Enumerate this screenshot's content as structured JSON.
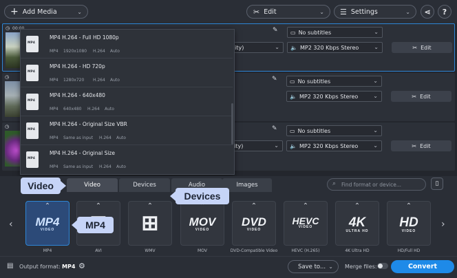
{
  "toolbar": {
    "add_media": "Add Media",
    "edit": "Edit",
    "settings": "Settings",
    "share_icon": "share-icon",
    "help": "?"
  },
  "files": [
    {
      "time": "00:00",
      "subtitles": "No subtitles",
      "audio": "MP2 320 Kbps Stereo",
      "quality": "ality)",
      "edit": "Edit"
    },
    {
      "subtitles": "No subtitles",
      "audio": "MP2 320 Kbps Stereo",
      "edit": "Edit"
    },
    {
      "subtitles": "No subtitles",
      "audio": "MP2 320 Kbps Stereo",
      "quality": "ality)",
      "edit": "Edit"
    }
  ],
  "dropdown": {
    "items": [
      {
        "title": "MP4 H.264 - Full HD 1080p",
        "fmt": "MP4",
        "size": "1920x1080",
        "codec": "H.264",
        "rate": "Auto"
      },
      {
        "title": "MP4 H.264 - HD 720p",
        "fmt": "MP4",
        "size": "1280x720",
        "codec": "H.264",
        "rate": "Auto"
      },
      {
        "title": "MP4 H.264 - 640x480",
        "fmt": "MP4",
        "size": "640x480",
        "codec": "H.264",
        "rate": "Auto"
      },
      {
        "title": "MP4 H.264 - Original Size VBR",
        "fmt": "MP4",
        "size": "Same as input",
        "codec": "H.264",
        "rate": "Auto"
      },
      {
        "title": "MP4 H.264 - Original Size",
        "fmt": "MP4",
        "size": "Same as input",
        "codec": "H.264",
        "rate": "Auto"
      }
    ]
  },
  "tabs": [
    "Video",
    "Devices",
    "Audio",
    "Images"
  ],
  "search": {
    "placeholder": "Find format or device..."
  },
  "callouts": {
    "video": "Video",
    "devices": "Devices",
    "mp4": "MP4"
  },
  "formats": [
    {
      "logo": "MP4",
      "sub": "VIDEO",
      "label": "MP4"
    },
    {
      "logo": "⊞",
      "sub": "",
      "label": "AVI"
    },
    {
      "logo": "⊞",
      "sub": "",
      "label": "WMV"
    },
    {
      "logo": "MOV",
      "sub": "VIDEO",
      "label": "MOV"
    },
    {
      "logo": "DVD",
      "sub": "VIDEO",
      "label": "DVD-Compatible Video"
    },
    {
      "logo": "HEVC",
      "sub": "VIDEO",
      "label": "HEVC (H.265)"
    },
    {
      "logo": "4K",
      "sub": "ULTRA HD",
      "label": "4K Ultra HD"
    },
    {
      "logo": "HD",
      "sub": "VIDEO",
      "label": "HD/Full HD"
    }
  ],
  "bottom": {
    "output_label": "Output format:",
    "output_value": "MP4",
    "save_to": "Save to...",
    "merge": "Merge files:",
    "convert": "Convert"
  },
  "colors": {
    "accent": "#1e8ae8",
    "selection": "#2e86d6",
    "callout": "#c6d4f7"
  }
}
